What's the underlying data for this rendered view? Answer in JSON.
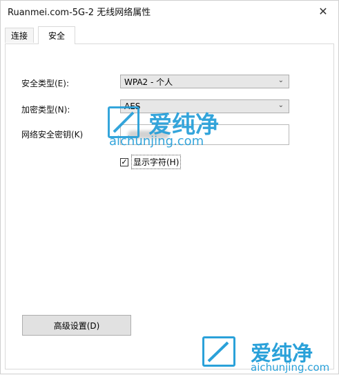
{
  "window": {
    "title": "Ruanmei.com-5G-2 无线网络属性",
    "close_glyph": "✕"
  },
  "tabs": [
    {
      "label": "连接",
      "active": false
    },
    {
      "label": "安全",
      "active": true
    }
  ],
  "form": {
    "security_type_label": "安全类型(E):",
    "security_type_value": "WPA2 - 个人",
    "encryption_type_label": "加密类型(N):",
    "encryption_type_value": "AES",
    "network_key_label": "网络安全密钥(K)",
    "network_key_value": "",
    "show_chars_label": "显示字符(H)",
    "show_chars_checked": true,
    "dropdown_glyph": "⌄",
    "check_glyph": "✓"
  },
  "buttons": {
    "advanced_label": "高级设置(D)"
  },
  "watermark": {
    "brand_cn": "爱纯净",
    "brand_url": "aichunjing.com"
  },
  "icons": {
    "close": "close-icon",
    "dropdown": "chevron-down-icon",
    "check": "check-icon",
    "watermark_logo": "brand-logo-icon"
  },
  "colors": {
    "watermark": "#1f9cd8",
    "select_bg": "#e7e7e7",
    "button_bg": "#e1e1e1"
  }
}
